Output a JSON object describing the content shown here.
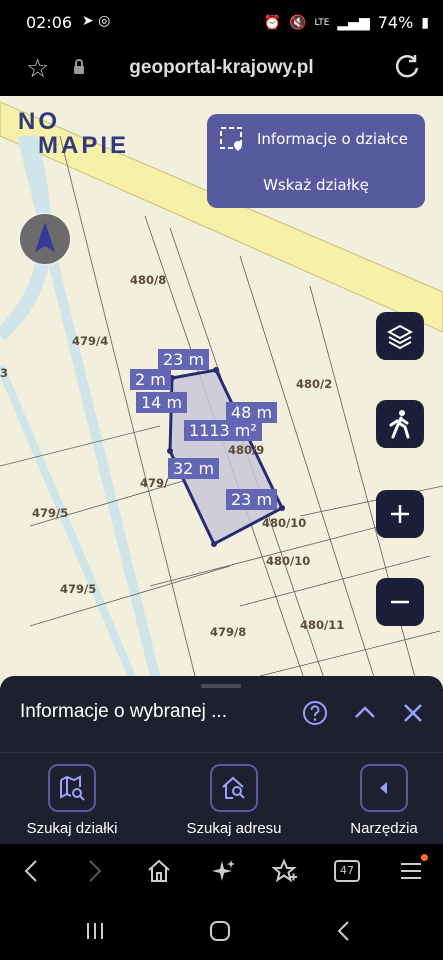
{
  "status": {
    "time": "02:06",
    "battery": "74%"
  },
  "browser": {
    "url": "geoportal-krajowy.pl",
    "tab_count": "47"
  },
  "map": {
    "logo": {
      "line1": "NO",
      "line2": "MAPIE"
    },
    "info_box": {
      "title": "Informacje o działce",
      "action": "Wskaż działkę"
    },
    "parcels": [
      "480/8",
      "479/4",
      "480/2",
      "480/9",
      "479/",
      "479/5",
      "480/10",
      "480/10",
      "479/5",
      "479/8",
      "480/11",
      "3"
    ],
    "measurements": [
      "23 m",
      "2 m",
      "14 m",
      "48 m",
      "1113 m²",
      "32 m",
      "23 m"
    ]
  },
  "panel": {
    "title": "Informacje o wybranej ...",
    "buttons": [
      {
        "label": "Szukaj działki",
        "icon": "map-search-icon"
      },
      {
        "label": "Szukaj adresu",
        "icon": "home-search-icon"
      },
      {
        "label": "Narzędzia",
        "icon": "chevron-left-icon"
      }
    ]
  },
  "colors": {
    "accent": "#585aa0",
    "panel": "#1e2030",
    "map_bg": "#f2efdc",
    "road": "#f6f0a8"
  }
}
